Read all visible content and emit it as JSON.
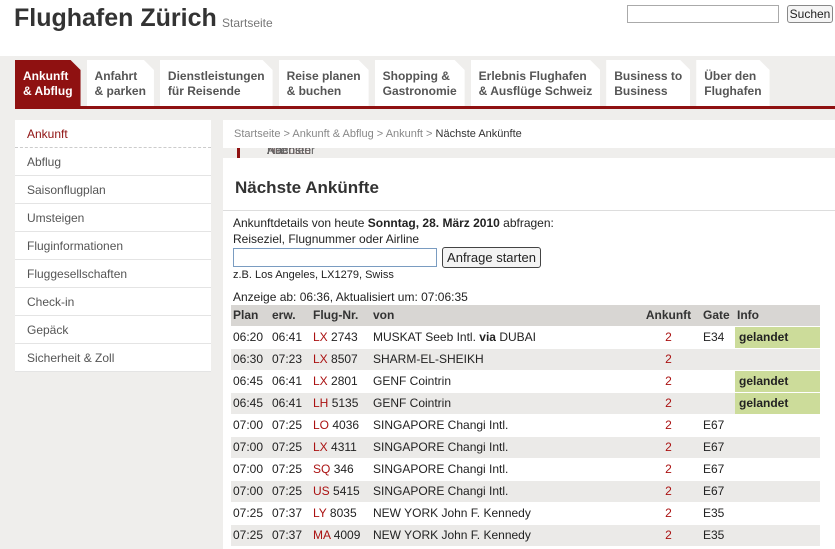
{
  "header": {
    "title": "Flughafen Zürich",
    "subtitle": "Startseite",
    "search_button": "Suchen",
    "search_value": ""
  },
  "tabs": [
    {
      "l1": "Ankunft",
      "l2": "& Abflug"
    },
    {
      "l1": "Anfahrt",
      "l2": "& parken"
    },
    {
      "l1": "Dienstleistungen",
      "l2": "für Reisende"
    },
    {
      "l1": "Reise planen",
      "l2": "& buchen"
    },
    {
      "l1": "Shopping &",
      "l2": "Gastronomie"
    },
    {
      "l1": "Erlebnis Flughafen",
      "l2": "& Ausflüge Schweiz"
    },
    {
      "l1": "Business to",
      "l2": "Business"
    },
    {
      "l1": "Über den",
      "l2": "Flughafen"
    }
  ],
  "sidebar": {
    "items": [
      "Ankunft",
      "Nächste Ankünfte",
      "Alle Ankünfte",
      "Nächster Tag",
      "Abholen",
      "Abflug",
      "Saisonflugplan",
      "Umsteigen",
      "Fluginformationen",
      "Fluggesellschaften",
      "Check-in",
      "Gepäck",
      "Sicherheit & Zoll"
    ]
  },
  "breadcrumb": [
    "Startseite",
    "Ankunft & Abflug",
    "Ankunft",
    "Nächste Ankünfte"
  ],
  "main": {
    "title": "Nächste Ankünfte",
    "query_prefix": "Ankunftdetails von heute ",
    "query_date": "Sonntag, 28. März 2010",
    "query_suffix": " abfragen:",
    "query_label": "Reiseziel, Flugnummer oder Airline",
    "input_value": "",
    "button": "Anfrage starten",
    "example": "z.B. Los Angeles, LX1279, Swiss",
    "updated": "Anzeige ab: 06:36, Aktualisiert um: 07:06:35"
  },
  "table": {
    "headers": [
      "Plan",
      "erw.",
      "Flug-Nr.",
      "von",
      "Ankunft",
      "Gate",
      "Info"
    ],
    "rows": [
      {
        "plan": "06:20",
        "erw": "06:41",
        "al": "LX",
        "nr": "2743",
        "von": "MUSKAT Seeb Intl.",
        "via": "via",
        "via_dest": "DUBAI",
        "ank": "2",
        "gate": "E34",
        "info": "gelandet"
      },
      {
        "plan": "06:30",
        "erw": "07:23",
        "al": "LX",
        "nr": "8507",
        "von": "SHARM-EL-SHEIKH",
        "ank": "2",
        "gate": "",
        "info": ""
      },
      {
        "plan": "06:45",
        "erw": "06:41",
        "al": "LX",
        "nr": "2801",
        "von": "GENF Cointrin",
        "ank": "2",
        "gate": "",
        "info": "gelandet"
      },
      {
        "plan": "06:45",
        "erw": "06:41",
        "al": "LH",
        "nr": "5135",
        "von": "GENF Cointrin",
        "ank": "2",
        "gate": "",
        "info": "gelandet"
      },
      {
        "plan": "07:00",
        "erw": "07:25",
        "al": "LO",
        "nr": "4036",
        "von": "SINGAPORE Changi Intl.",
        "ank": "2",
        "gate": "E67",
        "info": ""
      },
      {
        "plan": "07:00",
        "erw": "07:25",
        "al": "LX",
        "nr": "4311",
        "von": "SINGAPORE Changi Intl.",
        "ank": "2",
        "gate": "E67",
        "info": ""
      },
      {
        "plan": "07:00",
        "erw": "07:25",
        "al": "SQ",
        "nr": "346",
        "von": "SINGAPORE Changi Intl.",
        "ank": "2",
        "gate": "E67",
        "info": ""
      },
      {
        "plan": "07:00",
        "erw": "07:25",
        "al": "US",
        "nr": "5415",
        "von": "SINGAPORE Changi Intl.",
        "ank": "2",
        "gate": "E67",
        "info": ""
      },
      {
        "plan": "07:25",
        "erw": "07:37",
        "al": "LY",
        "nr": "8035",
        "von": "NEW YORK John F. Kennedy",
        "ank": "2",
        "gate": "E35",
        "info": ""
      },
      {
        "plan": "07:25",
        "erw": "07:37",
        "al": "MA",
        "nr": "4009",
        "von": "NEW YORK John F. Kennedy",
        "ank": "2",
        "gate": "E35",
        "info": ""
      }
    ]
  }
}
